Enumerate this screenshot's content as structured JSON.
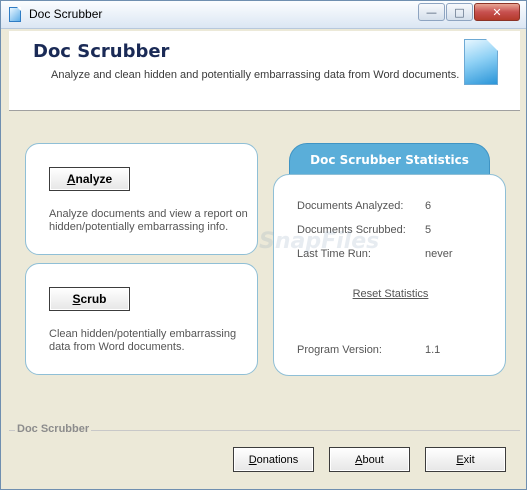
{
  "window": {
    "title": "Doc Scrubber",
    "buttons": {
      "minimize": "—",
      "maximize": "□",
      "close": "✕"
    }
  },
  "header": {
    "title": "Doc Scrubber",
    "subtitle": "Analyze and clean hidden and potentially embarrassing data from Word documents."
  },
  "analyze": {
    "button_label_accel": "A",
    "button_label_rest": "nalyze",
    "description": "Analyze documents and view a report on hidden/potentially embarrassing info."
  },
  "scrub": {
    "button_label_accel": "S",
    "button_label_rest": "crub",
    "description": "Clean hidden/potentially embarrassing data from Word documents."
  },
  "stats": {
    "heading": "Doc Scrubber Statistics",
    "documents_analyzed_label": "Documents Analyzed:",
    "documents_analyzed_value": "6",
    "documents_scrubbed_label": "Documents Scrubbed:",
    "documents_scrubbed_value": "5",
    "last_time_run_label": "Last Time Run:",
    "last_time_run_value": "never",
    "reset_link": "Reset Statistics",
    "program_version_label": "Program Version:",
    "program_version_value": "1.1"
  },
  "watermark": "SnapFiles",
  "footer": {
    "group_label": "Doc Scrubber",
    "donations_accel": "D",
    "donations_rest": "onations",
    "about_accel": "A",
    "about_rest": "bout",
    "exit_accel": "E",
    "exit_rest": "xit"
  },
  "colors": {
    "accent": "#5aaed9",
    "header_title": "#1a2a56",
    "panel_border": "#8fbfd6"
  }
}
